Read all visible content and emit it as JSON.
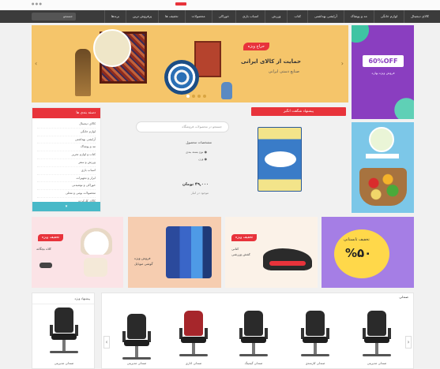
{
  "topbar": {
    "links": "● ● ●"
  },
  "nav": {
    "search_placeholder": "جستجو",
    "items": [
      "کالای دیجیتال",
      "لوازم خانگی",
      "مد و پوشاک",
      "آرایشی بهداشتی",
      "کتاب",
      "ورزش",
      "اسباب بازی",
      "خوراکی",
      "محصولات",
      "تخفیف ها",
      "پرفروش ترین",
      "برندها"
    ]
  },
  "hero": {
    "badge": "حراج ویژه",
    "title": "حمایت از کالای ایرانی",
    "subtitle": "صنایع دستی ایرانی",
    "prev": "‹",
    "next": "›"
  },
  "promo_off": {
    "label": "60%OFF",
    "sub": "فروش ویژه بهاره"
  },
  "categories": {
    "title": "دسته بندی ها",
    "items": [
      "کالای دیجیتال",
      "لوازم خانگی",
      "آرایشی بهداشتی",
      "مد و پوشاک",
      "کتاب و لوازم تحریر",
      "ورزش و سفر",
      "اسباب بازی",
      "ابزار و تجهیزات",
      "خوراکی و نوشیدنی",
      "محصولات بومی و محلی",
      "کالای کارکرده",
      "خدمات"
    ],
    "more": "▾"
  },
  "middle": {
    "search_placeholder": "جستجو در محصولات فروشگاه",
    "info_title": "مشخصات محصول",
    "info_lines": [
      "● نوع بسته بندی",
      "● وزن"
    ],
    "price": "۴۹,۰۰۰ تومان",
    "price_note": "موجود در انبار"
  },
  "featured": {
    "title": "پیشنهاد شگفت انگیز"
  },
  "tiles": [
    {
      "label": "تخفیف ویژه",
      "text1": "کلاه بچگانه",
      "text2": ""
    },
    {
      "label": "",
      "text1": "فروش ویژه",
      "text2": "گوشی موبایل"
    },
    {
      "label": "تخفیف ویژه",
      "text1": "کتانی",
      "text2": "کفش ورزشی"
    },
    {
      "label": "",
      "text1": "تخفیف تابستانی",
      "text2": "%۵۰"
    }
  ],
  "bottom": {
    "left_title": "پیشنهاد ویژه",
    "carousel_title": "صندلی",
    "prev": "‹",
    "next": "›",
    "products": [
      "صندلی مدیریتی",
      "صندلی اداری",
      "صندلی گیمینگ",
      "صندلی کارمندی",
      "صندلی مدیریتی"
    ],
    "left_product": "صندلی مدیریتی"
  }
}
